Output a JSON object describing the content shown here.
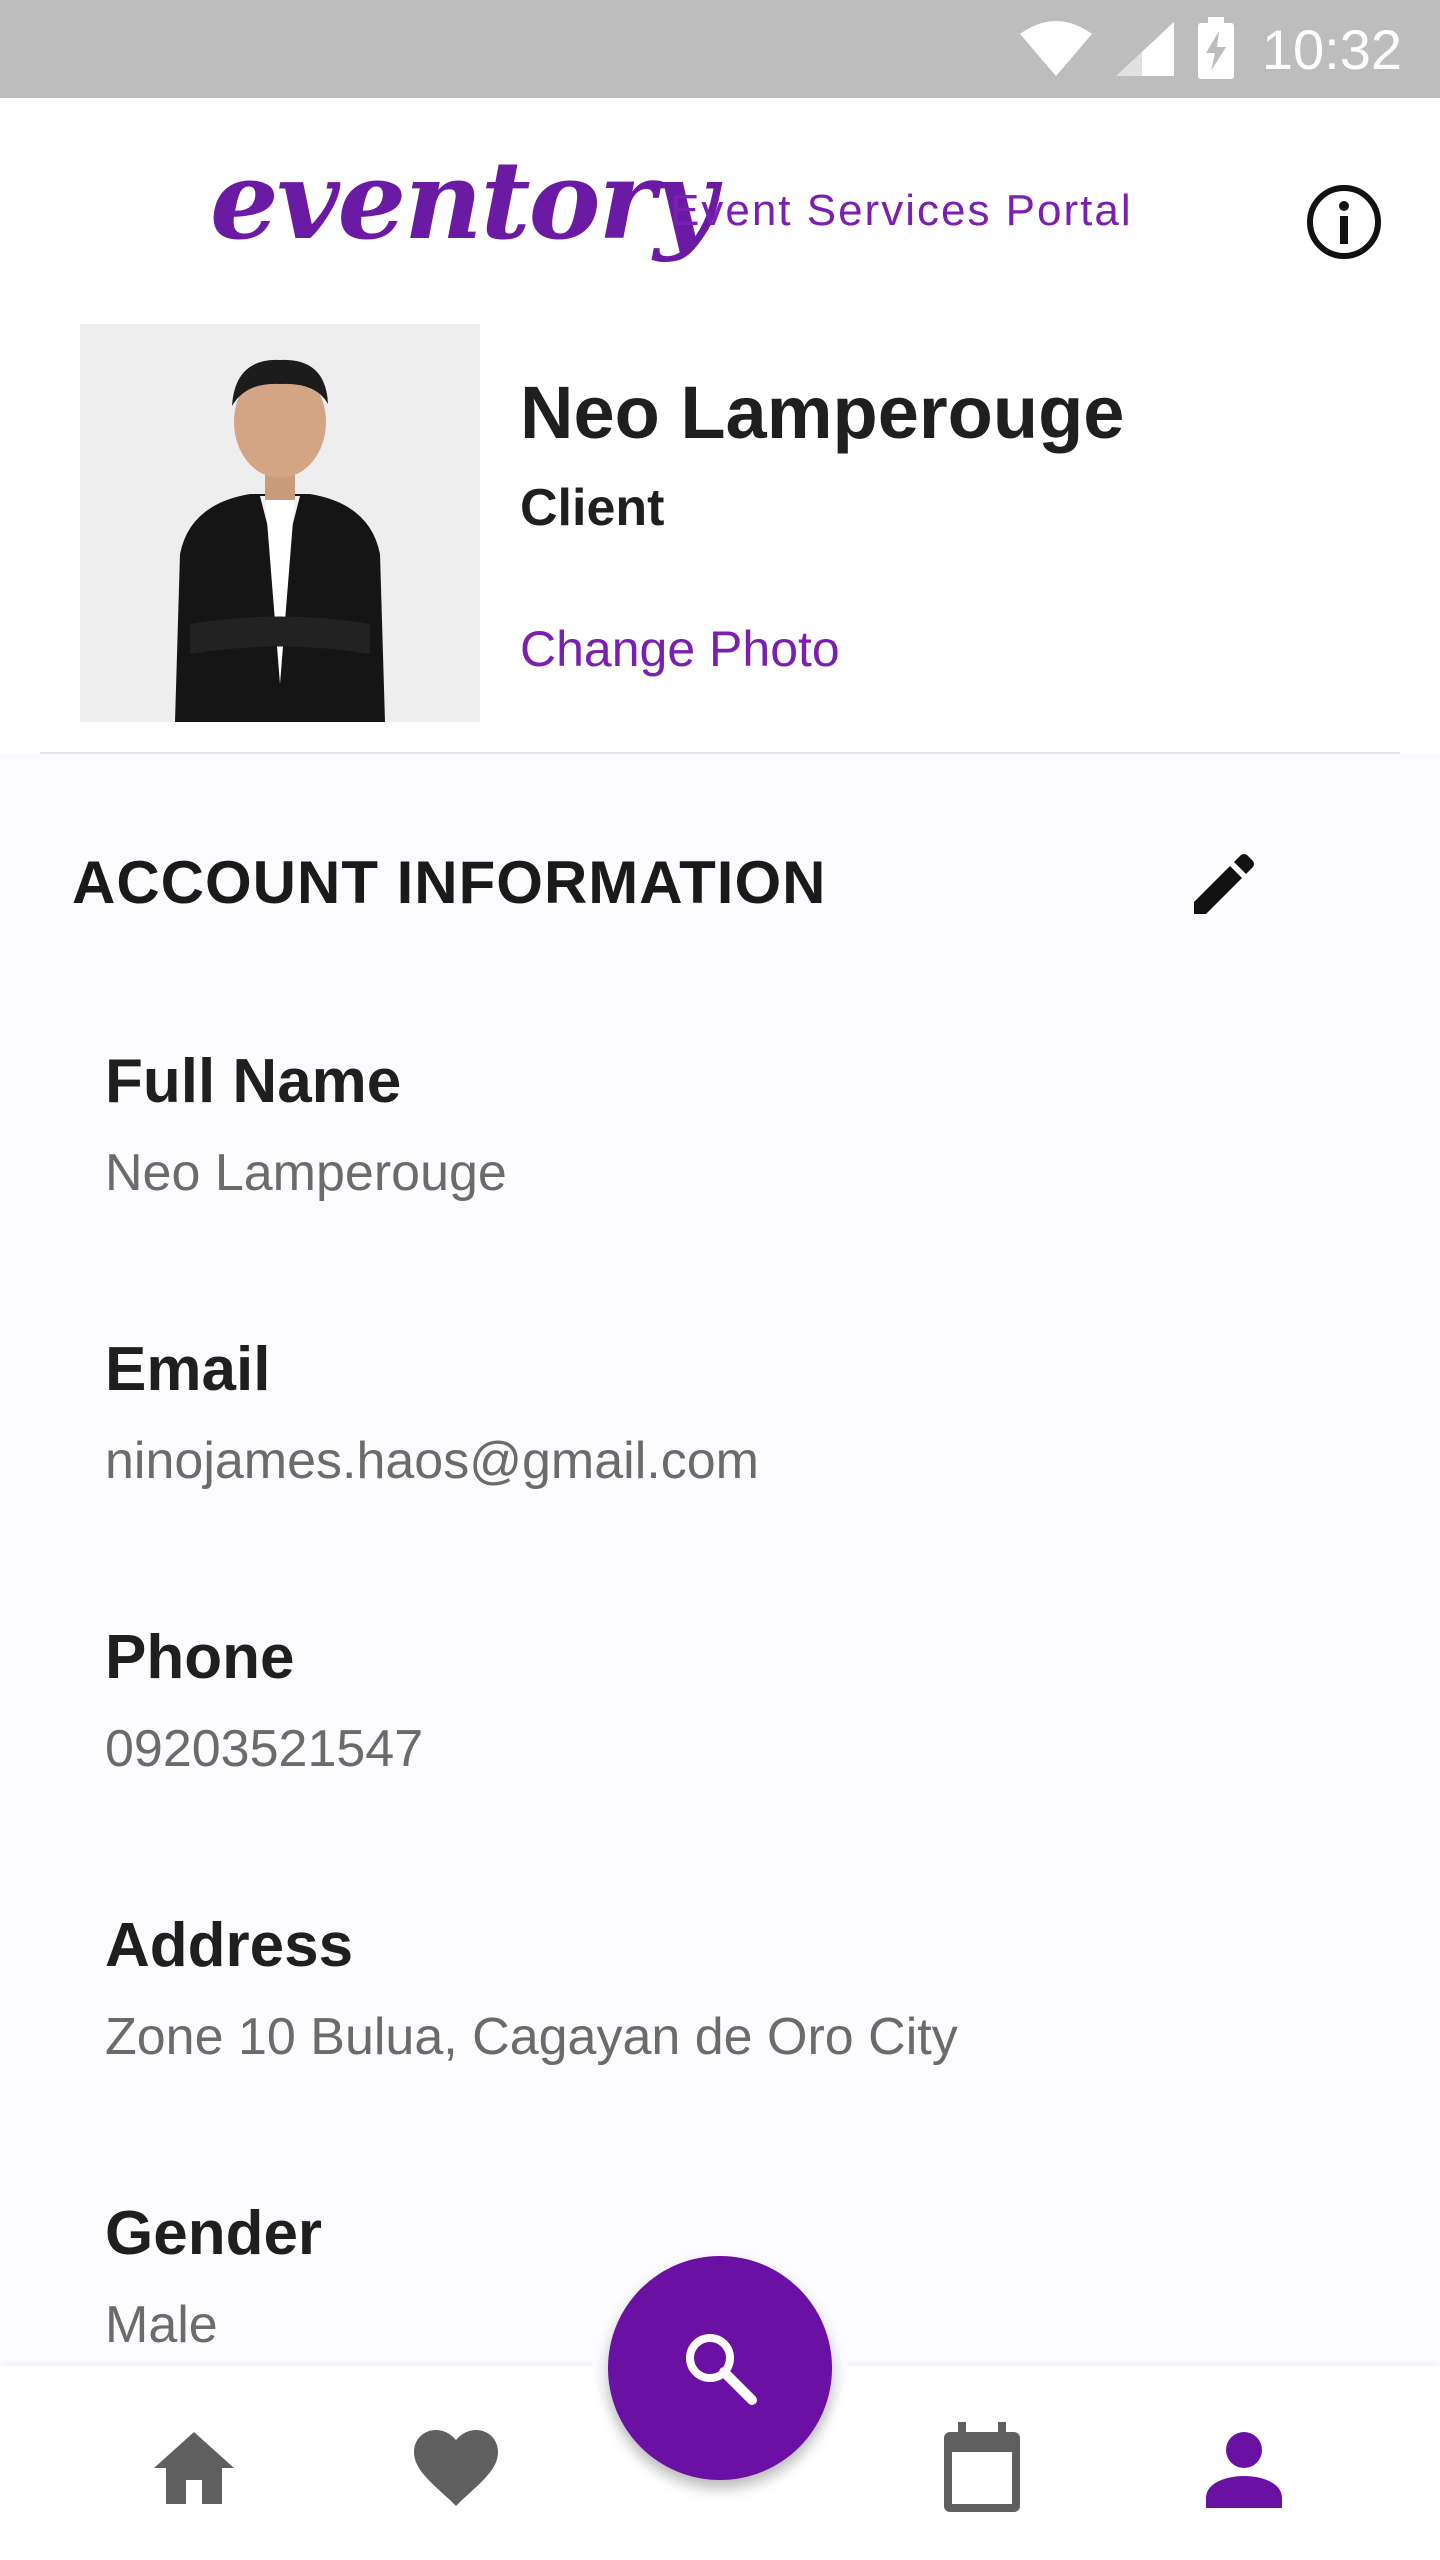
{
  "status_bar": {
    "time": "10:32"
  },
  "header": {
    "logo_text": "eventory",
    "subtitle": "Event Services Portal"
  },
  "profile": {
    "name": "Neo Lamperouge",
    "role": "Client",
    "change_photo_label": "Change Photo"
  },
  "account": {
    "section_title": "ACCOUNT INFORMATION",
    "fields": [
      {
        "label": "Full Name",
        "value": "Neo Lamperouge"
      },
      {
        "label": "Email",
        "value": "ninojames.haos@gmail.com"
      },
      {
        "label": "Phone",
        "value": "09203521547"
      },
      {
        "label": "Address",
        "value": "Zone 10 Bulua, Cagayan de Oro City"
      },
      {
        "label": "Gender",
        "value": "Male"
      }
    ]
  },
  "bottom_nav": {
    "items": [
      {
        "icon": "home-icon",
        "active": false
      },
      {
        "icon": "heart-icon",
        "active": false
      },
      {
        "icon": "search-icon",
        "active": false
      },
      {
        "icon": "calendar-icon",
        "active": false
      },
      {
        "icon": "person-icon",
        "active": true
      }
    ]
  },
  "colors": {
    "accent": "#6a10a3",
    "status_bar": "#bdbdbd",
    "inactive_icon": "#5f5f5f",
    "secondary_text": "#6b6b6b"
  }
}
